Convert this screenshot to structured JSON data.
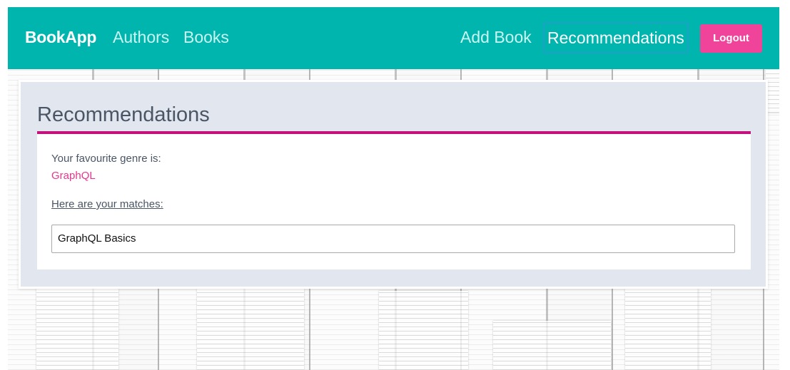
{
  "navbar": {
    "brand": "BookApp",
    "links": {
      "authors": "Authors",
      "books": "Books",
      "add_book": "Add Book",
      "recommendations": "Recommendations"
    },
    "logout_label": "Logout"
  },
  "recommendations": {
    "title": "Recommendations",
    "genre_label": "Your favourite genre is:",
    "genre_value": "GraphQL",
    "matches_label": "Here are your matches:",
    "matches": [
      "GraphQL Basics"
    ]
  },
  "colors": {
    "navbar_bg": "#00b5ad",
    "logout_bg": "#f0439a",
    "title_rule": "#c4117c",
    "genre_accent": "#e8358d",
    "card_bg": "#e1e6ef"
  }
}
